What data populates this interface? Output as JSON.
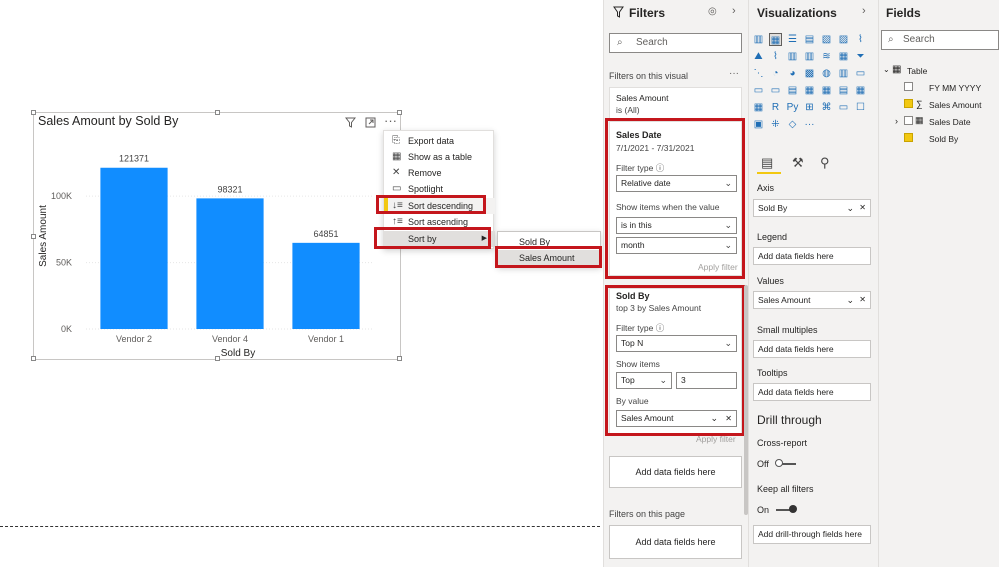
{
  "visual": {
    "title": "Sales Amount by Sold By",
    "header_icons": [
      "filter-icon",
      "focus-icon",
      "more-icon"
    ]
  },
  "chart_data": {
    "type": "bar",
    "title": "Sales Amount by Sold By",
    "xlabel": "Sold By",
    "ylabel": "Sales Amount",
    "categories": [
      "Vendor 2",
      "Vendor 4",
      "Vendor 1"
    ],
    "values": [
      121371,
      98321,
      64851
    ],
    "data_labels": [
      "121371",
      "98321",
      "64851"
    ],
    "yticks": [
      0,
      50000,
      100000
    ],
    "ytick_labels": [
      "0K",
      "50K",
      "100K"
    ],
    "ylim": [
      0,
      140000
    ],
    "bar_color": "#118dff",
    "grid": true
  },
  "context_menu": {
    "items": [
      {
        "label": "Export data",
        "icon": "export-icon"
      },
      {
        "label": "Show as a table",
        "icon": "table-icon"
      },
      {
        "label": "Remove",
        "icon": "close-icon"
      },
      {
        "label": "Spotlight",
        "icon": "spotlight-icon"
      },
      {
        "label": "Sort descending",
        "icon": "sort-descending-icon"
      },
      {
        "label": "Sort ascending",
        "icon": "sort-ascending-icon"
      },
      {
        "label": "Sort by",
        "icon": "chevron-right-icon"
      }
    ],
    "submenu": [
      "Sold By",
      "Sales Amount"
    ]
  },
  "filters": {
    "title": "Filters",
    "search_placeholder": "Search",
    "on_visual_label": "Filters on this visual",
    "sales_amount_card": {
      "title": "Sales Amount",
      "sub": "is (All)"
    },
    "sales_date_card": {
      "title": "Sales Date",
      "sub": "7/1/2021 - 7/31/2021",
      "filter_type_label": "Filter type",
      "filter_type_value": "Relative date",
      "show_items_label": "Show items when the value",
      "condition_value": "is in this",
      "period_value": "month",
      "apply": "Apply filter"
    },
    "sold_by_card": {
      "title": "Sold By",
      "sub": "top 3 by Sales Amount",
      "filter_type_label": "Filter type",
      "filter_type_value": "Top N",
      "show_items_label": "Show items",
      "show_items_dir": "Top",
      "show_items_count": "3",
      "by_value_label": "By value",
      "by_value_field": "Sales Amount",
      "apply": "Apply filter"
    },
    "add_fields_label": "Add data fields here",
    "on_page_label": "Filters on this page",
    "add_fields_page_label": "Add data fields here"
  },
  "visualizations": {
    "title": "Visualizations",
    "axis_label": "Axis",
    "axis_value": "Sold By",
    "legend_label": "Legend",
    "legend_value": "Add data fields here",
    "values_label": "Values",
    "values_value": "Sales Amount",
    "small_multiples_label": "Small multiples",
    "small_multiples_value": "Add data fields here",
    "tooltips_label": "Tooltips",
    "tooltips_value": "Add data fields here",
    "drill_through_label": "Drill through",
    "cross_report_label": "Cross-report",
    "cross_report_state": "Off",
    "keep_filters_label": "Keep all filters",
    "keep_filters_state": "On",
    "drill_add_label": "Add drill-through fields here",
    "accent": "#f2c811"
  },
  "fields": {
    "title": "Fields",
    "search_placeholder": "Search",
    "table_name": "Table",
    "items": [
      {
        "label": "FY MM YYYY",
        "checked": false
      },
      {
        "label": "Sales Amount",
        "checked": true
      },
      {
        "label": "Sales Date",
        "checked": false
      },
      {
        "label": "Sold By",
        "checked": true
      }
    ]
  }
}
